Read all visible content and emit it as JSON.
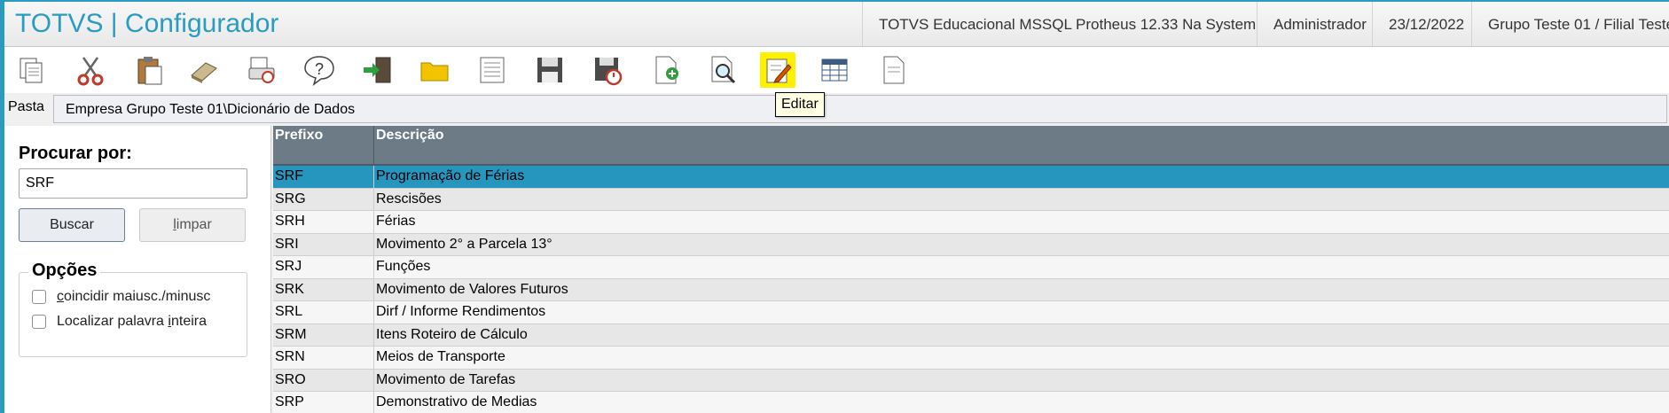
{
  "app": {
    "title": "TOTVS | Configurador",
    "environment": "TOTVS Educacional MSSQL Protheus 12.33 Na System",
    "user": "Administrador",
    "date": "23/12/2022",
    "branch": "Grupo Teste 01 / Filial Teste"
  },
  "toolbar": {
    "buttons": [
      "copy-icon",
      "cut-icon",
      "paste-icon",
      "eraser-icon",
      "print-preview-icon",
      "help-icon",
      "exit-icon",
      "folder-icon",
      "list-icon",
      "save-icon",
      "save-history-icon",
      "new-document-icon",
      "search-document-icon",
      "edit-icon",
      "table-icon",
      "blank-document-icon"
    ],
    "highlighted": "edit-icon",
    "tooltip": "Editar"
  },
  "path": {
    "label": "Pasta",
    "value": "Empresa Grupo Teste 01\\Dicionário de Dados"
  },
  "search": {
    "title": "Procurar por:",
    "value": "SRF",
    "buscar_label": "Buscar",
    "limpar_prefix": "",
    "limpar_underline": "l",
    "limpar_rest": "impar"
  },
  "options": {
    "title": "Opções",
    "match_case_underline": "c",
    "match_case_rest": "oincidir maiusc./minusc",
    "whole_word_prefix": "Localizar palavra ",
    "whole_word_underline": "i",
    "whole_word_rest": "nteira"
  },
  "grid": {
    "headers": {
      "prefix": "Prefixo",
      "description": "Descrição"
    },
    "selected_index": 0,
    "rows": [
      {
        "prefix": "SRF",
        "description": "Programação de Férias"
      },
      {
        "prefix": "SRG",
        "description": "Rescisões"
      },
      {
        "prefix": "SRH",
        "description": "Férias"
      },
      {
        "prefix": "SRI",
        "description": "Movimento 2° a Parcela 13°"
      },
      {
        "prefix": "SRJ",
        "description": "Funções"
      },
      {
        "prefix": "SRK",
        "description": "Movimento de Valores Futuros"
      },
      {
        "prefix": "SRL",
        "description": "Dirf / Informe Rendimentos"
      },
      {
        "prefix": "SRM",
        "description": "Itens Roteiro de Cálculo"
      },
      {
        "prefix": "SRN",
        "description": "Meios de Transporte"
      },
      {
        "prefix": "SRO",
        "description": "Movimento de Tarefas"
      },
      {
        "prefix": "SRP",
        "description": "Demonstrativo de Medias"
      }
    ]
  },
  "colors": {
    "brand": "#2a9bc1",
    "selection": "#2596be",
    "header": "#6c7b86",
    "highlight": "#fdf100"
  }
}
